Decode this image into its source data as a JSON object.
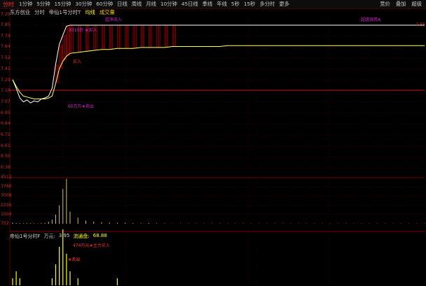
{
  "toolbar": {
    "brand": "分时",
    "periods": [
      "1分钟",
      "5分钟",
      "15分钟",
      "30分钟",
      "60分钟",
      "日线",
      "周线",
      "月线",
      "10分钟",
      "45日线",
      "季线",
      "年线",
      "5秒",
      "15秒",
      "多分时",
      "更多"
    ],
    "right_buttons": [
      "竞价",
      "叠加",
      "超级"
    ]
  },
  "subheader": {
    "stock": "东方创业",
    "view": "分时",
    "indicator": "帝仙1号分时T",
    "avg_label": "均线",
    "vol_label": "成交量"
  },
  "price_axis": {
    "top_left": "7.29",
    "left": [
      "7.85",
      "7.74",
      "7.64",
      "7.52",
      "7.41",
      "7.29",
      "7.18",
      "7.07",
      "6.95",
      "6.84",
      "6.72",
      "6.61",
      "6.50",
      "6.38"
    ],
    "top_right": "7.85"
  },
  "volume_axis": [
    "4512",
    "3760",
    "3008",
    "2256",
    "1504",
    "752"
  ],
  "annotations": {
    "top_left_magenta": "超净流入",
    "top_right_magenta": "超级强势A",
    "buy_big": "3010万 ★买入",
    "buy_small": "买入",
    "sell_label": "60万万★卖出",
    "ind_buy": "474万元★主力买入",
    "ind_sell": "★卖出"
  },
  "indicator": {
    "name": "帝仙1号分时F",
    "unit": "万元:",
    "value": "3.95",
    "flow_label": "流通盘:",
    "flow_value": "68.88"
  },
  "colors": {
    "background": "#000000",
    "grid": "#5a0000",
    "price_line": "#ffffff",
    "avg_line": "#ffff66",
    "volume": "#d0c060",
    "ind_bar": "#ffff00",
    "ref_line": "#ff2020"
  },
  "chart_data": {
    "type": "line",
    "title": "",
    "xlabel": "",
    "ylabel": "",
    "ylim": [
      6.38,
      7.85
    ],
    "series": [
      {
        "name": "price",
        "values": [
          7.29,
          7.2,
          7.1,
          7.06,
          7.08,
          7.05,
          7.07,
          7.06,
          7.09,
          7.1,
          7.12,
          7.2,
          7.45,
          7.65,
          7.75,
          7.84,
          7.85,
          7.85,
          7.85,
          7.85,
          7.85,
          7.85,
          7.85,
          7.85,
          7.85,
          7.85,
          7.85,
          7.85,
          7.85,
          7.85,
          7.85,
          7.85,
          7.85,
          7.85,
          7.85,
          7.85,
          7.85,
          7.85,
          7.85,
          7.85,
          7.85,
          7.85,
          7.85,
          7.85,
          7.85,
          7.85,
          7.85,
          7.85,
          7.85,
          7.85,
          7.85,
          7.85,
          7.85,
          7.85,
          7.85,
          7.85,
          7.85,
          7.85,
          7.85,
          7.85,
          7.85,
          7.85
        ]
      },
      {
        "name": "avg",
        "values": [
          7.29,
          7.22,
          7.16,
          7.12,
          7.11,
          7.1,
          7.09,
          7.09,
          7.09,
          7.09,
          7.1,
          7.12,
          7.25,
          7.4,
          7.48,
          7.53,
          7.56,
          7.57,
          7.58,
          7.59,
          7.6,
          7.6,
          7.61,
          7.61,
          7.61,
          7.62,
          7.62,
          7.62,
          7.62,
          7.63,
          7.63,
          7.63,
          7.63,
          7.63,
          7.63,
          7.63,
          7.64,
          7.64,
          7.64,
          7.64,
          7.64,
          7.64,
          7.64,
          7.64,
          7.64,
          7.64,
          7.64,
          7.64,
          7.64,
          7.64,
          7.64,
          7.64,
          7.64,
          7.64,
          7.64,
          7.64,
          7.64,
          7.64,
          7.64,
          7.64,
          7.64,
          7.64
        ]
      }
    ],
    "volume": [
      120,
      80,
      60,
      40,
      60,
      50,
      40,
      30,
      60,
      80,
      200,
      400,
      900,
      1800,
      3400,
      4400,
      1200,
      600,
      300,
      200,
      150,
      120,
      100,
      80,
      60,
      40,
      60,
      40,
      30,
      20,
      20,
      20,
      20,
      20,
      20,
      20,
      20,
      20,
      20,
      20,
      20,
      20,
      20,
      20,
      20,
      20,
      20,
      20,
      20,
      20,
      20,
      20,
      20,
      20,
      20,
      20,
      20,
      20,
      20,
      20,
      20,
      20
    ],
    "ind_bars": [
      10,
      20,
      10,
      0,
      0,
      0,
      0,
      0,
      0,
      0,
      0,
      10,
      30,
      55,
      80,
      45,
      20,
      10,
      0,
      0,
      0,
      0,
      10,
      0,
      0,
      0,
      0,
      0,
      0,
      0,
      0,
      0,
      0,
      0,
      0,
      0,
      0,
      0,
      0,
      0,
      0,
      0,
      0,
      0,
      0,
      0,
      0,
      0,
      0,
      0,
      0,
      0,
      0,
      0,
      0,
      0,
      0,
      0,
      0,
      0,
      0,
      0
    ]
  }
}
